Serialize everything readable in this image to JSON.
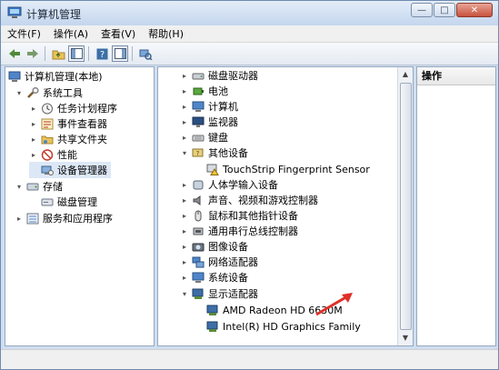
{
  "window": {
    "title": "计算机管理"
  },
  "menu": [
    "文件(F)",
    "操作(A)",
    "查看(V)",
    "帮助(H)"
  ],
  "left_tree": [
    {
      "label": "计算机管理(本地)",
      "level": 0,
      "expander": "",
      "icon": "computer-icon"
    },
    {
      "label": "系统工具",
      "level": 1,
      "expander": "▾",
      "icon": "tools-icon"
    },
    {
      "label": "任务计划程序",
      "level": 2,
      "expander": "▸",
      "icon": "clock-icon"
    },
    {
      "label": "事件查看器",
      "level": 2,
      "expander": "▸",
      "icon": "event-viewer-icon"
    },
    {
      "label": "共享文件夹",
      "level": 2,
      "expander": "▸",
      "icon": "shared-folder-icon"
    },
    {
      "label": "性能",
      "level": 2,
      "expander": "▸",
      "icon": "performance-icon"
    },
    {
      "label": "设备管理器",
      "level": 2,
      "expander": "",
      "icon": "device-manager-icon",
      "selected": true
    },
    {
      "label": "存储",
      "level": 0,
      "expander": "▾",
      "icon": "storage-icon"
    },
    {
      "label": "磁盘管理",
      "level": 1,
      "expander": "",
      "icon": "disk-icon"
    },
    {
      "label": "服务和应用程序",
      "level": 0,
      "expander": "▸",
      "icon": "services-icon"
    }
  ],
  "device_tree": [
    {
      "label": "磁盘驱动器",
      "level": 0,
      "expander": "▸",
      "icon": "disk-drive-icon"
    },
    {
      "label": "电池",
      "level": 0,
      "expander": "▸",
      "icon": "battery-icon"
    },
    {
      "label": "计算机",
      "level": 0,
      "expander": "▸",
      "icon": "computer-icon"
    },
    {
      "label": "监视器",
      "level": 0,
      "expander": "▸",
      "icon": "monitor-icon"
    },
    {
      "label": "键盘",
      "level": 0,
      "expander": "▸",
      "icon": "keyboard-icon"
    },
    {
      "label": "其他设备",
      "level": 0,
      "expander": "▾",
      "icon": "other-devices-icon"
    },
    {
      "label": "TouchStrip Fingerprint Sensor",
      "level": 1,
      "expander": "",
      "icon": "warning-device-icon"
    },
    {
      "label": "人体学输入设备",
      "level": 0,
      "expander": "▸",
      "icon": "hid-icon"
    },
    {
      "label": "声音、视频和游戏控制器",
      "level": 0,
      "expander": "▸",
      "icon": "speaker-icon"
    },
    {
      "label": "鼠标和其他指针设备",
      "level": 0,
      "expander": "▸",
      "icon": "mouse-icon"
    },
    {
      "label": "通用串行总线控制器",
      "level": 0,
      "expander": "▸",
      "icon": "usb-icon"
    },
    {
      "label": "图像设备",
      "level": 0,
      "expander": "▸",
      "icon": "camera-icon"
    },
    {
      "label": "网络适配器",
      "level": 0,
      "expander": "▸",
      "icon": "network-icon"
    },
    {
      "label": "系统设备",
      "level": 0,
      "expander": "▸",
      "icon": "system-device-icon"
    },
    {
      "label": "显示适配器",
      "level": 0,
      "expander": "▾",
      "icon": "display-adapter-icon"
    },
    {
      "label": "AMD Radeon HD 6630M",
      "level": 1,
      "expander": "",
      "icon": "display-adapter-icon"
    },
    {
      "label": "Intel(R) HD Graphics Family",
      "level": 1,
      "expander": "",
      "icon": "display-adapter-icon"
    }
  ],
  "actions": {
    "header": "操作"
  },
  "colors": {
    "accent": "#3a6ea5",
    "annotation_arrow": "#e0302a",
    "selection": "#dde8f6"
  }
}
